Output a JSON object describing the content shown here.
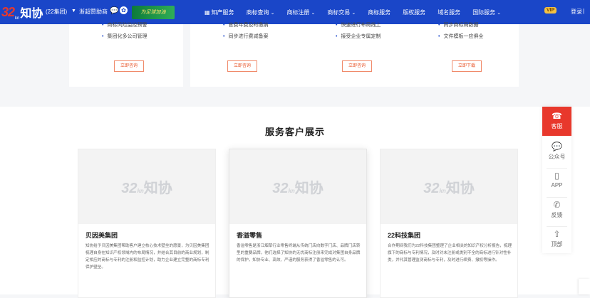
{
  "header": {
    "logo_num": "32",
    "logo_sub": "kn",
    "logo_name": "知协",
    "group": "(22集团)",
    "city": "浙超赞助商",
    "banner_text": "为足球加油",
    "nav": [
      {
        "label": "知产服务",
        "has_chevron": false,
        "icon": "grid-icon"
      },
      {
        "label": "商标查询",
        "has_chevron": true
      },
      {
        "label": "商标注册",
        "has_chevron": true
      },
      {
        "label": "商标交易",
        "has_chevron": true
      },
      {
        "label": "商标服务",
        "has_chevron": false
      },
      {
        "label": "版权服务",
        "has_chevron": false
      },
      {
        "label": "域名服务",
        "has_chevron": false
      },
      {
        "label": "国际服务",
        "has_chevron": true
      }
    ],
    "vip": "VIP",
    "login": "登录",
    "separator": "|"
  },
  "services": [
    {
      "items": [
        "商标风险监控预警",
        "集团化多公司管理"
      ],
      "button": "立即咨询"
    },
    {
      "items": [
        "官费年费及时缴纳",
        "同步进行费减备案"
      ],
      "button": "立即咨询"
    },
    {
      "items": [
        "快速进行布局线上",
        "接受企业专属定制"
      ],
      "button": "立即咨询"
    },
    {
      "items": [
        "同步商标局数据",
        "文件模板一应俱全"
      ],
      "button": "立即下载"
    }
  ],
  "section_title": "服务客户展示",
  "watermark": {
    "num": "32",
    "sub": "kn",
    "name": "知协"
  },
  "cases": [
    {
      "name": "贝因美集团",
      "desc": "知协给予贝因美集团帮助客户建立核心技术壁垒的愿景，为贝因美集团梳理自身在知识产权领域内的布局情况，并结合其目前的商业规划，制定相应的商标与专利的注册和监控计划，助力企业建立完整的商标专利保护壁垒。"
    },
    {
      "name": "香溢零售",
      "desc": "香溢零售是浙江烟草行业零售终端从传统门店向数字门店、品牌门店转型的重要品牌，他们选择了知协的无忧商标注册来完成对集团自身品牌的保护，知协专业、高效、严谨的服务获得了香溢零售的认可。"
    },
    {
      "name": "22科技集团",
      "desc": "合作期间我们为22科技集团整理了企业相关的知识产权分析报告，梳理旗下的商标与专利情况，及时对未注册或类别不全的商标进行针对性补类，并代其管理监测商标与专利，及时进行续费、撤权等操作。"
    }
  ],
  "sidebar": [
    {
      "label": "客服",
      "icon": "headset-icon"
    },
    {
      "label": "公众号",
      "icon": "wechat-icon"
    },
    {
      "label": "APP",
      "icon": "phone-icon"
    },
    {
      "label": "反馈",
      "icon": "feedback-icon"
    },
    {
      "label": "顶部",
      "icon": "arrow-up-icon"
    }
  ],
  "colors": {
    "header_bg": "#1a46c8",
    "accent_red": "#e8382c",
    "button_border": "#f08a6a"
  }
}
